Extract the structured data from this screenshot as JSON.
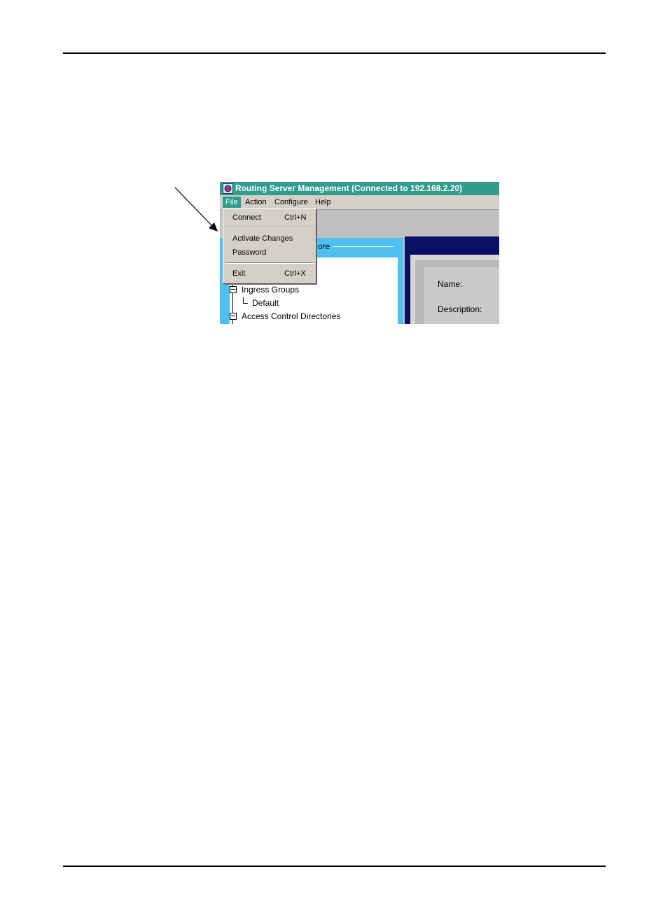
{
  "window": {
    "title": "Routing Server Management (Connected to 192.168.2.20)",
    "icon": "app-icon"
  },
  "menubar": {
    "items": [
      {
        "label": "File",
        "active": true
      },
      {
        "label": "Action"
      },
      {
        "label": "Configure"
      },
      {
        "label": "Help"
      }
    ]
  },
  "file_menu": {
    "items": [
      {
        "label": "Connect",
        "shortcut": "Ctrl+N"
      },
      {
        "label": "Activate Changes",
        "shortcut": ""
      },
      {
        "label": "Password",
        "shortcut": ""
      },
      {
        "label": "Exit",
        "shortcut": "Ctrl+X"
      }
    ]
  },
  "left_panel": {
    "group_label_fragment": "ore",
    "tree": [
      {
        "label": "Ingress Groups"
      },
      {
        "label": "Default"
      },
      {
        "label": "Access Control Directories"
      }
    ]
  },
  "right_panel": {
    "name_label": "Name:",
    "description_label": "Description:"
  },
  "colors": {
    "titlebar": "#2f9c8c",
    "tree_frame": "#4ec1f0",
    "right_frame": "#0a1064",
    "menu_bg": "#d4d0c8"
  }
}
